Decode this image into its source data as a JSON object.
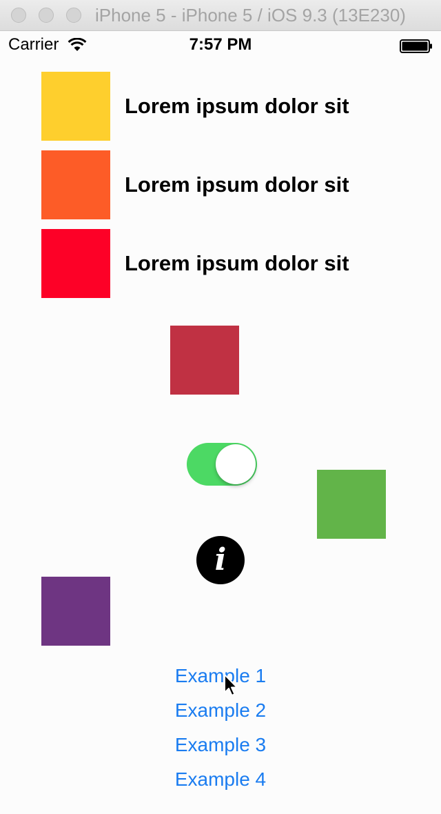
{
  "window": {
    "title": "iPhone 5 - iPhone 5 / iOS 9.3 (13E230)"
  },
  "status_bar": {
    "carrier": "Carrier",
    "time": "7:57 PM",
    "wifi_icon": "wifi-icon",
    "battery_icon": "battery-icon"
  },
  "rows": [
    {
      "label": "Lorem ipsum dolor sit",
      "color": "#fecf2d"
    },
    {
      "label": "Lorem ipsum dolor sit",
      "color": "#fd5c27"
    },
    {
      "label": "Lorem ipsum dolor sit",
      "color": "#fd0127"
    }
  ],
  "squares": {
    "crimson": "#c03143",
    "green": "#62b449",
    "purple": "#6e3582"
  },
  "switch": {
    "on": true,
    "color": "#4cd964"
  },
  "info_button": {
    "glyph": "i",
    "icon": "info-icon"
  },
  "links": [
    {
      "label": "Example 1"
    },
    {
      "label": "Example 2"
    },
    {
      "label": "Example 3"
    },
    {
      "label": "Example 4"
    }
  ],
  "accent_color": "#1a7cf0"
}
